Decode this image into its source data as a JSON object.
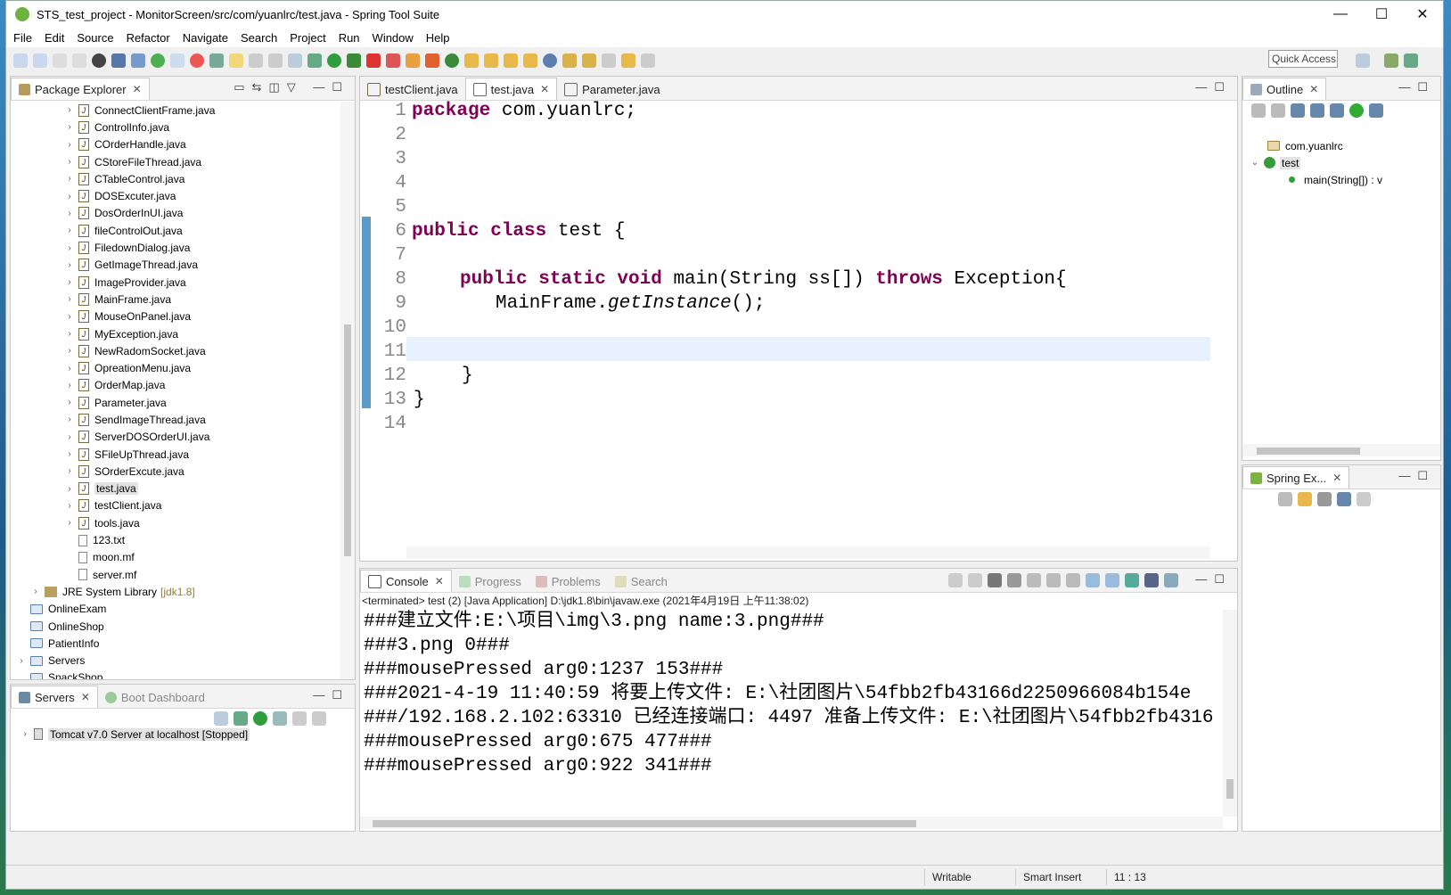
{
  "window": {
    "title": "STS_test_project - MonitorScreen/src/com/yuanlrc/test.java - Spring Tool Suite"
  },
  "menu": [
    "File",
    "Edit",
    "Source",
    "Refactor",
    "Navigate",
    "Search",
    "Project",
    "Run",
    "Window",
    "Help"
  ],
  "toolbar": {
    "quick_access": "Quick Access"
  },
  "package_explorer": {
    "tab": "Package Explorer",
    "files": [
      "ConnectClientFrame.java",
      "ControlInfo.java",
      "COrderHandle.java",
      "CStoreFileThread.java",
      "CTableControl.java",
      "DOSExcuter.java",
      "DosOrderInUI.java",
      "fileControlOut.java",
      "FiledownDialog.java",
      "GetImageThread.java",
      "ImageProvider.java",
      "MainFrame.java",
      "MouseOnPanel.java",
      "MyException.java",
      "NewRadomSocket.java",
      "OpreationMenu.java",
      "OrderMap.java",
      "Parameter.java",
      "SendImageThread.java",
      "ServerDOSOrderUI.java",
      "SFileUpThread.java",
      "SOrderExcute.java",
      "test.java",
      "testClient.java",
      "tools.java"
    ],
    "text_files": [
      "123.txt",
      "moon.mf",
      "server.mf"
    ],
    "jre": "JRE System Library",
    "jre_ver": "[jdk1.8]",
    "projects": [
      "OnlineExam",
      "OnlineShop",
      "PatientInfo",
      "Servers",
      "SnackShop"
    ]
  },
  "servers_panel": {
    "tab": "Servers",
    "tab2": "Boot Dashboard",
    "server": "Tomcat v7.0 Server at localhost  [Stopped]"
  },
  "editor": {
    "tabs": [
      "testClient.java",
      "test.java",
      "Parameter.java"
    ],
    "line_numbers": [
      "1",
      "2",
      "3",
      "4",
      "5",
      "6",
      "7",
      "8",
      "9",
      "10",
      "11",
      "12",
      "13",
      "14"
    ],
    "l1_kw": "package",
    "l1_rest": " com.yuanlrc;",
    "l6_kw": "public class",
    "l6_rest": " test {",
    "l8_kw1": "public static void",
    "l8_mid": " main(String ss[]) ",
    "l8_kw2": "throws",
    "l8_rest": " Exception{",
    "l9_a": "MainFrame.",
    "l9_b": "getInstance",
    "l9_c": "();",
    "l12": "}",
    "l13": "}"
  },
  "outline": {
    "tab": "Outline",
    "pkg": "com.yuanlrc",
    "cls": "test",
    "method": "main(String[]) : v"
  },
  "spring_explorer": {
    "tab": "Spring Ex..."
  },
  "console": {
    "tabs": [
      "Console",
      "Progress",
      "Problems",
      "Search"
    ],
    "terminated": "<terminated> test (2) [Java Application] D:\\jdk1.8\\bin\\javaw.exe (2021年4月19日 上午11:38:02)",
    "lines": [
      "###建立文件:E:\\项目\\img\\3.png name:3.png###",
      "###3.png 0###",
      "###mousePressed arg0:1237 153###",
      "###2021-4-19 11:40:59 将要上传文件: E:\\社团图片\\54fbb2fb43166d2250966084b154e",
      "###/192.168.2.102:63310 已经连接端口: 4497 准备上传文件: E:\\社团图片\\54fbb2fb4316",
      "###mousePressed arg0:675 477###",
      "###mousePressed arg0:922 341###"
    ]
  },
  "status": {
    "writable": "Writable",
    "insert": "Smart Insert",
    "pos": "11 : 13"
  }
}
